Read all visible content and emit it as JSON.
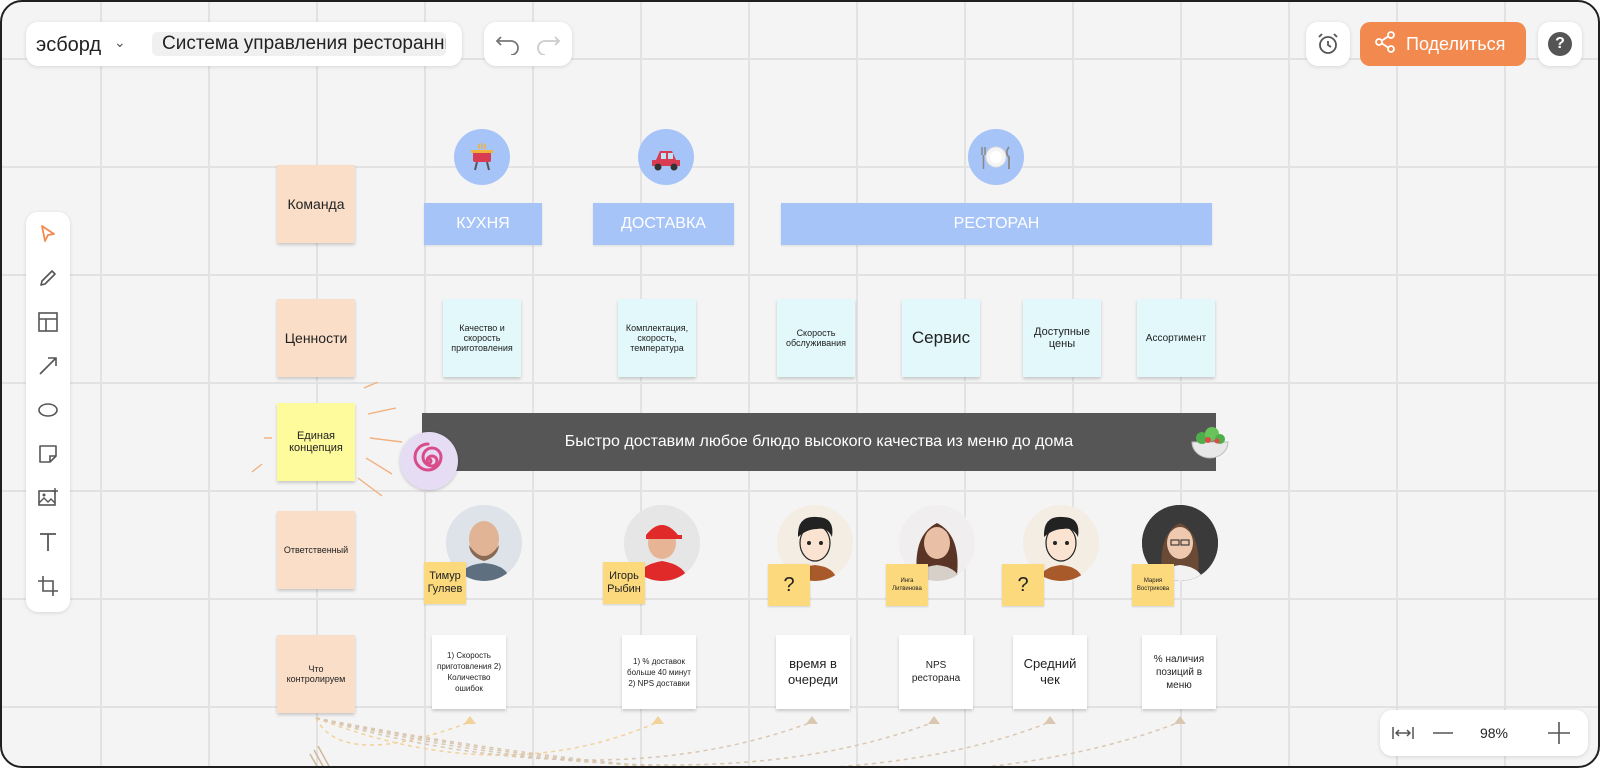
{
  "app": {
    "name": "эсборд",
    "board_title": "Система управления ресторанным бизнесом"
  },
  "header": {
    "share_label": "Поделиться",
    "help_label": "?"
  },
  "zoom": {
    "value": "98%"
  },
  "toolbar": {
    "tools": [
      "select",
      "pen",
      "template",
      "arrow",
      "ellipse",
      "sticky-note",
      "image",
      "text",
      "frame"
    ]
  },
  "board": {
    "row_labels": {
      "team": "Команда",
      "values": "Ценности",
      "concept": "Единая концепция",
      "responsible": "Ответственный",
      "controls": "Что контролируем"
    },
    "teams": {
      "kitchen": "КУХНЯ",
      "delivery": "ДОСТАВКА",
      "restaurant": "РЕСТОРАН"
    },
    "values": {
      "v1": "Качество и скорость приготовления",
      "v2": "Комплектация, скорость, температура",
      "v3": "Скорость обслуживания",
      "v4": "Сервис",
      "v5": "Доступные цены",
      "v6": "Ассортимент"
    },
    "concept_banner": "Быстро доставим любое блюдо высокого качества из меню до дома",
    "responsible": {
      "r1": "Тимур Гуляев",
      "r2": "Игорь Рыбин",
      "r3": "?",
      "r4": "Инга Литвинова",
      "r5": "?",
      "r6": "Мария Вострикова"
    },
    "controls": {
      "c1": "1) Скорость приготовления 2) Количество ошибок",
      "c2": "1) % доставок больше 40 минут 2) NPS доставки",
      "c3": "время в очереди",
      "c4": "NPS ресторана",
      "c5": "Средний чек",
      "c6": "% наличия позиций в меню"
    }
  },
  "colors": {
    "accent": "#f2894f",
    "team_blue": "#a6c4f8",
    "peach": "#fadec8",
    "cyan": "#e2f8fb",
    "yellow": "#fdfb9b",
    "note": "#fbd97c",
    "banner": "#565656"
  }
}
